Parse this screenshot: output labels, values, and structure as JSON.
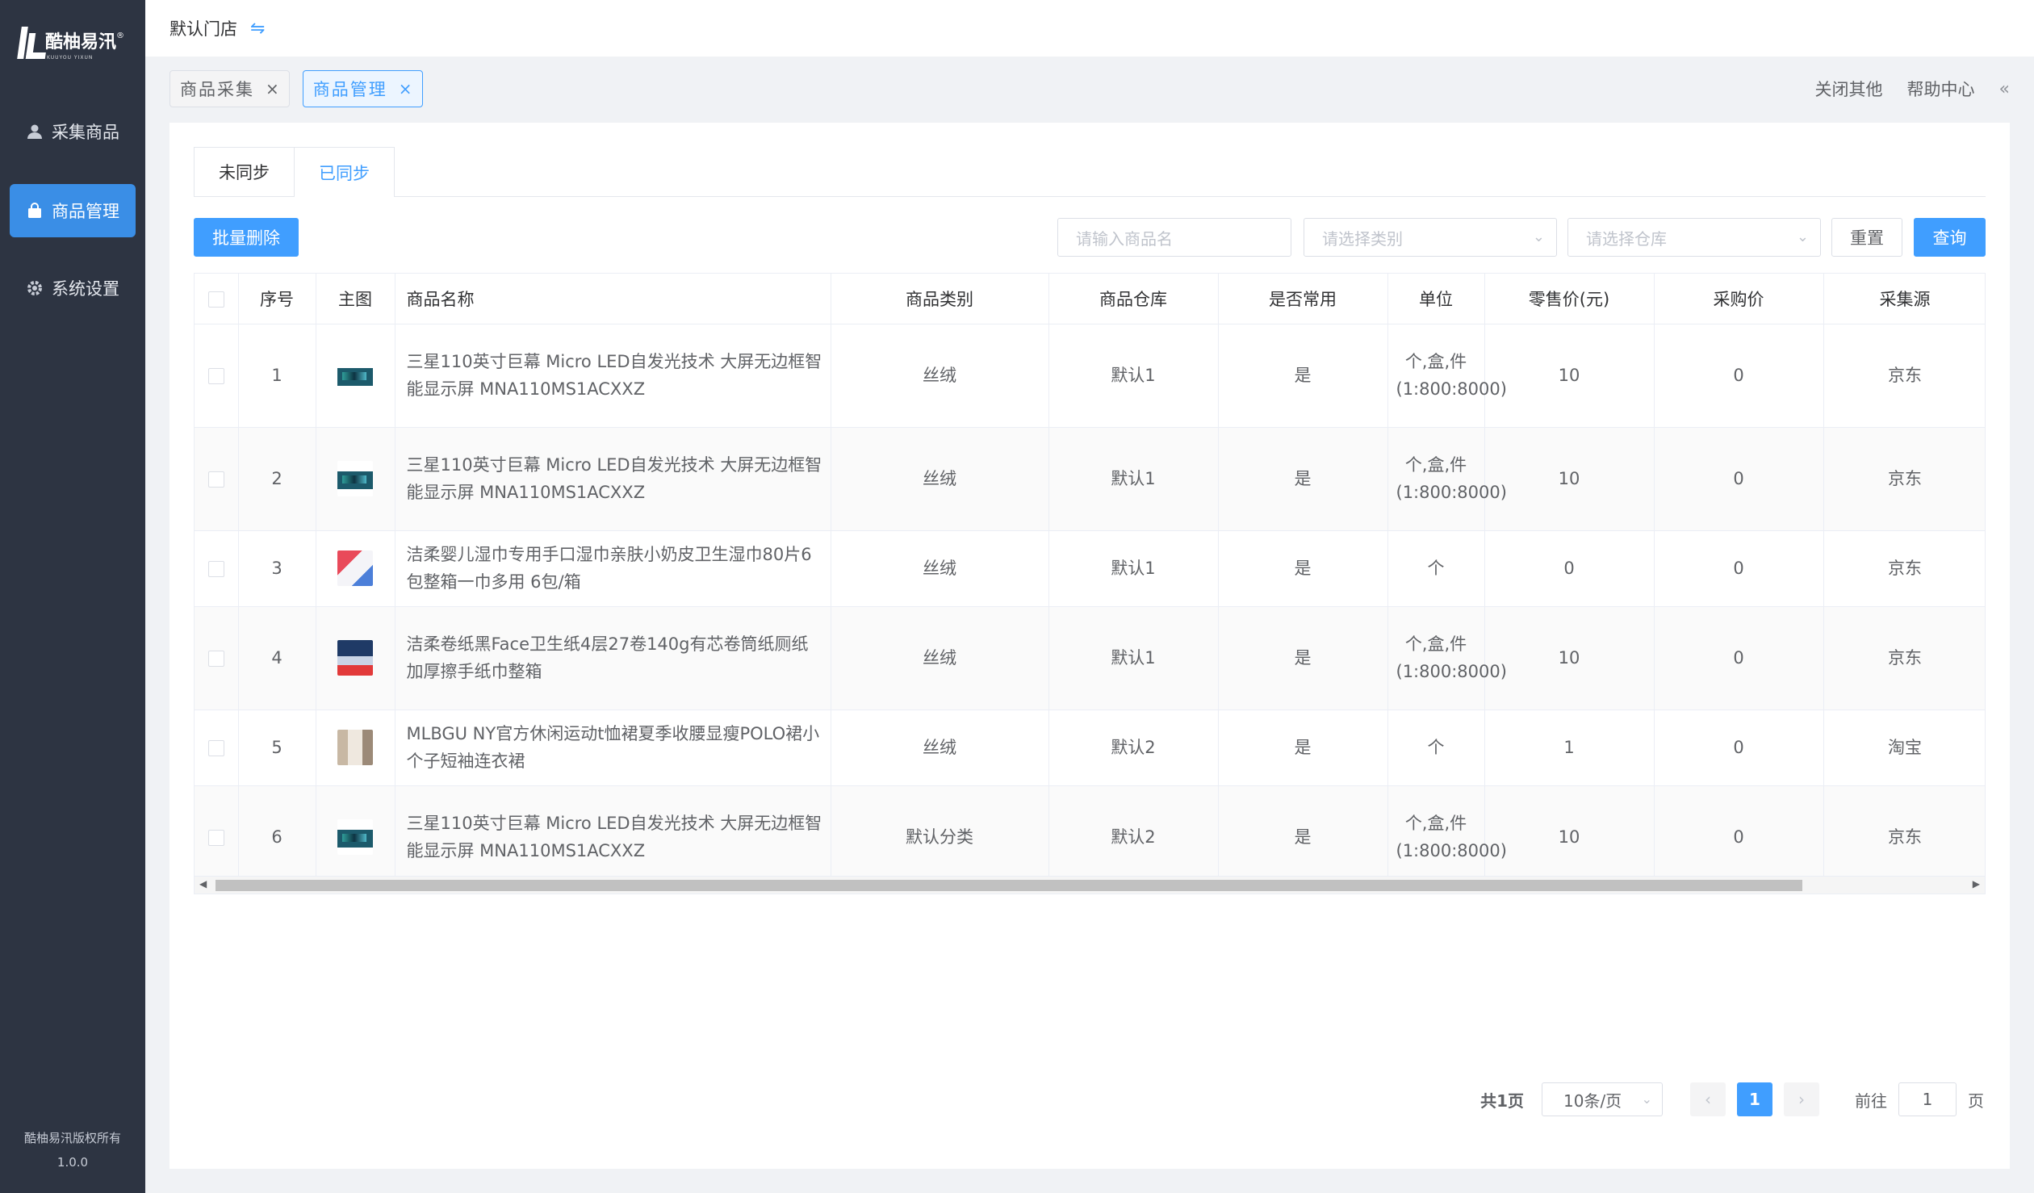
{
  "brand": {
    "name": "酷柚易汛",
    "registered_mark": "®",
    "tagline": "KUUYOU YIXUN"
  },
  "sidebar": {
    "items": [
      {
        "label": "采集商品",
        "icon": "user-icon",
        "active": false
      },
      {
        "label": "商品管理",
        "icon": "bag-icon",
        "active": true
      },
      {
        "label": "系统设置",
        "icon": "gear-icon",
        "active": false
      }
    ],
    "copyright": "酷柚易汛版权所有",
    "version": "1.0.0"
  },
  "topbar": {
    "store": "默认门店",
    "switch_icon": "swap-icon"
  },
  "tabs": {
    "items": [
      {
        "label": "商品采集",
        "active": false
      },
      {
        "label": "商品管理",
        "active": true
      }
    ],
    "close_others": "关闭其他",
    "help": "帮助中心",
    "collapse_icon": "double-chevron-left-icon"
  },
  "subtabs": [
    {
      "label": "未同步",
      "selected": false
    },
    {
      "label": "已同步",
      "selected": true
    }
  ],
  "toolbar": {
    "batch_delete": "批量删除",
    "name_placeholder": "请输入商品名",
    "category_placeholder": "请选择类别",
    "warehouse_placeholder": "请选择仓库",
    "reset": "重置",
    "query": "查询"
  },
  "table": {
    "headers": {
      "index": "序号",
      "image": "主图",
      "name": "商品名称",
      "category": "商品类别",
      "warehouse": "商品仓库",
      "common": "是否常用",
      "unit": "单位",
      "retail": "零售价(元)",
      "purchase": "采购价",
      "source": "采集源"
    },
    "rows": [
      {
        "index": "1",
        "thumb": "tv",
        "name": "三星110英寸巨幕 Micro LED自发光技术 大屏无边框智能显示屏 MNA110MS1ACXXZ",
        "category": "丝绒",
        "warehouse": "默认1",
        "common": "是",
        "unit": "个,盒,件(1:800:8000)",
        "retail": "10",
        "purchase": "0",
        "source": "京东"
      },
      {
        "index": "2",
        "thumb": "tv",
        "name": "三星110英寸巨幕 Micro LED自发光技术 大屏无边框智能显示屏 MNA110MS1ACXXZ",
        "category": "丝绒",
        "warehouse": "默认1",
        "common": "是",
        "unit": "个,盒,件(1:800:8000)",
        "retail": "10",
        "purchase": "0",
        "source": "京东"
      },
      {
        "index": "3",
        "thumb": "wipe",
        "name": "洁柔婴儿湿巾专用手口湿巾亲肤小奶皮卫生湿巾80片6包整箱一巾多用 6包/箱",
        "category": "丝绒",
        "warehouse": "默认1",
        "common": "是",
        "unit": "个",
        "retail": "0",
        "purchase": "0",
        "source": "京东"
      },
      {
        "index": "4",
        "thumb": "tissue",
        "name": "洁柔卷纸黑Face卫生纸4层27卷140g有芯卷筒纸厕纸加厚擦手纸巾整箱",
        "category": "丝绒",
        "warehouse": "默认1",
        "common": "是",
        "unit": "个,盒,件(1:800:8000)",
        "retail": "10",
        "purchase": "0",
        "source": "京东"
      },
      {
        "index": "5",
        "thumb": "dress",
        "name": "MLBGU NY官方休闲运动t恤裙夏季收腰显瘦POLO裙小个子短袖连衣裙",
        "category": "丝绒",
        "warehouse": "默认2",
        "common": "是",
        "unit": "个",
        "retail": "1",
        "purchase": "0",
        "source": "淘宝"
      },
      {
        "index": "6",
        "thumb": "tv",
        "name": "三星110英寸巨幕 Micro LED自发光技术 大屏无边框智能显示屏 MNA110MS1ACXXZ",
        "category": "默认分类",
        "warehouse": "默认2",
        "common": "是",
        "unit": "个,盒,件(1:800:8000)",
        "retail": "10",
        "purchase": "0",
        "source": "京东"
      }
    ]
  },
  "pagination": {
    "total": "共1页",
    "page_size": "10条/页",
    "current": "1",
    "goto_label": "前往",
    "goto_value": "1",
    "page_suffix": "页"
  }
}
